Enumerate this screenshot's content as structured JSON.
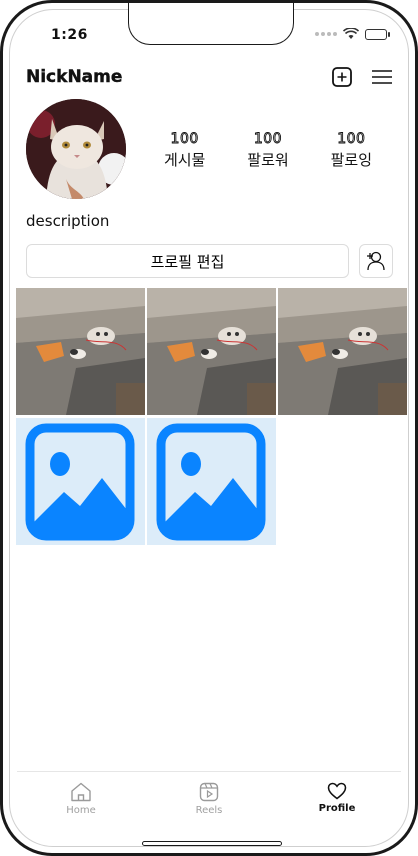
{
  "status_bar": {
    "time": "1:26"
  },
  "header": {
    "nickname": "NickName",
    "icons": {
      "add_post": "plus-square-icon",
      "menu": "hamburger-menu-icon"
    }
  },
  "profile": {
    "avatar_icon": "cat-avatar-photo",
    "stats": [
      {
        "count": "100",
        "label": "게시물"
      },
      {
        "count": "100",
        "label": "팔로워"
      },
      {
        "count": "100",
        "label": "팔로잉"
      }
    ],
    "description": "description",
    "edit_button_label": "프로필 편집",
    "add_friend_icon": "add-user-icon"
  },
  "grid": {
    "items": [
      {
        "type": "photo",
        "subject": "cat-on-bed"
      },
      {
        "type": "photo",
        "subject": "cat-on-bed"
      },
      {
        "type": "photo",
        "subject": "cat-on-bed"
      },
      {
        "type": "placeholder",
        "icon": "image-placeholder-icon"
      },
      {
        "type": "placeholder",
        "icon": "image-placeholder-icon"
      }
    ],
    "placeholder_color": "#0a84ff",
    "placeholder_bg": "#dcecf9"
  },
  "tabbar": {
    "tabs": [
      {
        "label": "Home",
        "icon": "home-icon",
        "active": false
      },
      {
        "label": "Reels",
        "icon": "reels-icon",
        "active": false
      },
      {
        "label": "Profile",
        "icon": "heart-icon",
        "active": true
      }
    ]
  }
}
